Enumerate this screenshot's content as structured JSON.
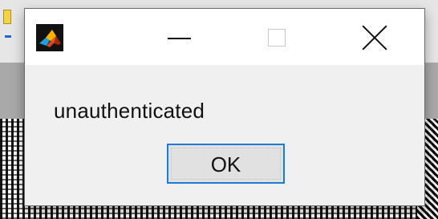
{
  "dialog": {
    "message": "unauthenticated",
    "ok_label": "OK",
    "icon": "matlab-logo-icon"
  },
  "titlebar": {
    "buttons": [
      "minimize-icon",
      "maximize-icon",
      "close-icon"
    ]
  },
  "colors": {
    "dialog_bg": "#f0f0f0",
    "titlebar_bg": "#ffffff",
    "ok_border": "#1f7ad6"
  }
}
